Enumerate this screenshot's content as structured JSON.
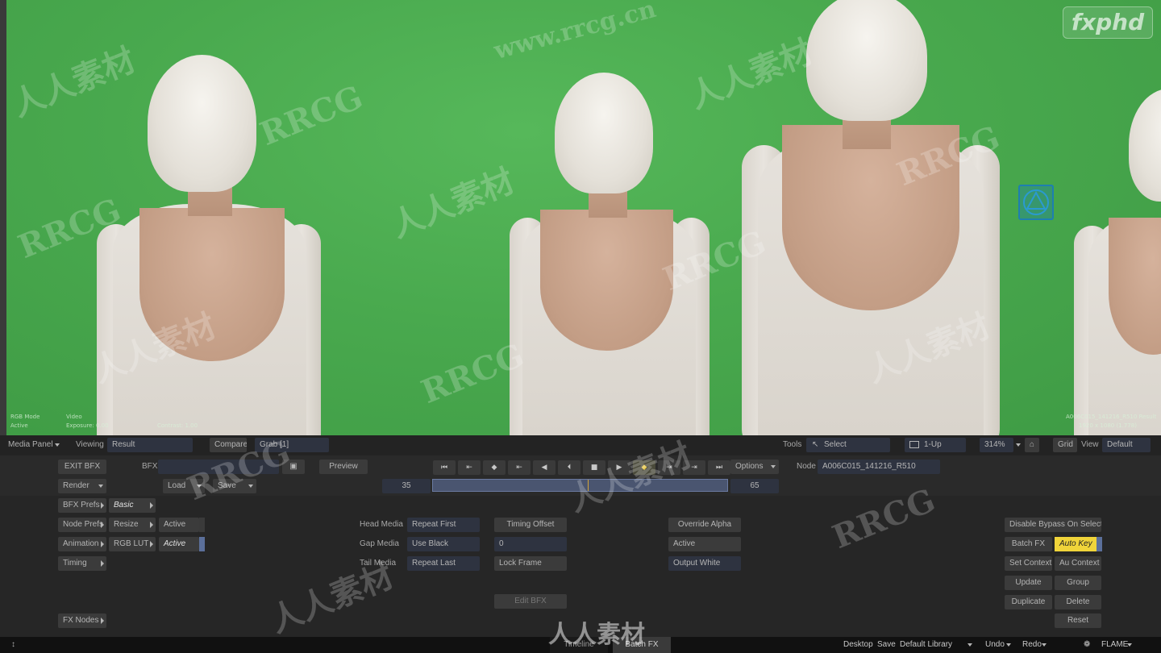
{
  "viewer": {
    "info_left": {
      "mode": "RGB Mode",
      "state": "Active",
      "view_type": "Video",
      "exposure": "Exposure: 0.00",
      "contrast": "Contrast: 1.00"
    },
    "info_right": {
      "clip": "A006C015_141216_R510 Result",
      "res": "1920 x 1080 (1.778)"
    },
    "logo": "fxphd"
  },
  "watermarks": [
    "www.rrcg.cn",
    "RRCG",
    "人人素材"
  ],
  "viewing_bar": {
    "media_panel": "Media Panel",
    "viewing_label": "Viewing",
    "viewing_value": "Result",
    "compare": "Compare",
    "grab": "Grab [1]",
    "tools_label": "Tools",
    "select": "Select",
    "layout": "1-Up",
    "zoom": "314%",
    "grid": "Grid",
    "view_label": "View",
    "view_value": "Default"
  },
  "toolbar": {
    "exit_bfx": "EXIT BFX",
    "bfx_label": "BFX",
    "preview": "Preview",
    "render": "Render",
    "load": "Load",
    "save": "Save",
    "options": "Options",
    "node_label": "Node",
    "node_value": "A006C015_141216_R510",
    "frame_start": "35",
    "frame_end": "65"
  },
  "panel": {
    "bfx_prefs": "BFX Prefs",
    "basic": "Basic",
    "node_prefs": "Node Prefs",
    "resize": "Resize",
    "active1": "Active",
    "animation": "Animation",
    "rgb_lut": "RGB LUT",
    "active2": "Active",
    "timing": "Timing",
    "fx_nodes": "FX Nodes",
    "head_media_label": "Head Media",
    "head_media_value": "Repeat First",
    "gap_media_label": "Gap Media",
    "gap_media_value": "Use Black",
    "tail_media_label": "Tail Media",
    "tail_media_value": "Repeat Last",
    "timing_offset": "Timing Offset",
    "timing_offset_value": "0",
    "lock_frame": "Lock Frame",
    "edit_bfx": "Edit BFX",
    "override_alpha": "Override Alpha",
    "alpha_active": "Active",
    "output_white": "Output White",
    "disable_bypass": "Disable Bypass On Selection",
    "batch_fx": "Batch FX",
    "auto_key": "Auto Key",
    "set_context": "Set Context",
    "au_context": "Au Context",
    "update": "Update",
    "group": "Group",
    "duplicate": "Duplicate",
    "delete": "Delete",
    "reset": "Reset"
  },
  "bottom_bar": {
    "tab_timeline": "Timeline",
    "tab_batch_fx": "Batch FX",
    "desktop": "Desktop",
    "save": "Save",
    "library": "Default Library",
    "undo": "Undo",
    "redo": "Redo",
    "app": "FLAME"
  },
  "colors": {
    "accent_yellow": "#f0d43a",
    "field_blue": "#2e3340",
    "green_screen": "#4aaa4f"
  }
}
